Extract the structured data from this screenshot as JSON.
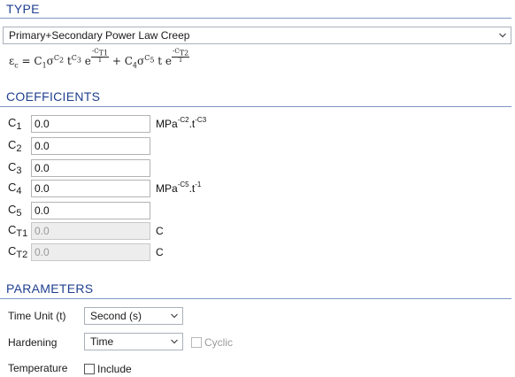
{
  "type_section": {
    "title": "TYPE",
    "model_select": {
      "value": "Primary+Secondary Power Law Creep"
    }
  },
  "formula": {
    "lhs": "ε",
    "lhs_sub": "c",
    "eq": " = C",
    "c1_sub": "1",
    "sigma1": "σ",
    "c2_sup": "C",
    "c2_sup_sub": "2",
    "t1": " t",
    "c3_sup": "C",
    "c3_sup_sub": "3",
    "e1": " e",
    "frac1_num": "-C",
    "frac1_num_sub": "T1",
    "frac1_den": "T",
    "plus": "  + C",
    "c4_sub": "4",
    "sigma2": "σ",
    "c5_sup": "C",
    "c5_sup_sub": "5",
    "t2": " t e",
    "frac2_num": "-C",
    "frac2_num_sub": "T2",
    "frac2_den": "T"
  },
  "coefficients": {
    "title": "COEFFICIENTS",
    "rows": [
      {
        "label": "C",
        "sub": "1",
        "value": "0.0",
        "unit": "MPa",
        "unit_sup1": "-C2",
        "unit_mid": ".t",
        "unit_sup2": "-C3"
      },
      {
        "label": "C",
        "sub": "2",
        "value": "0.0",
        "unit": "",
        "unit_sup1": "",
        "unit_mid": "",
        "unit_sup2": ""
      },
      {
        "label": "C",
        "sub": "3",
        "value": "0.0",
        "unit": "",
        "unit_sup1": "",
        "unit_mid": "",
        "unit_sup2": ""
      },
      {
        "label": "C",
        "sub": "4",
        "value": "0.0",
        "unit": "MPa",
        "unit_sup1": "-C5",
        "unit_mid": ".t",
        "unit_sup2": "-1"
      },
      {
        "label": "C",
        "sub": "5",
        "value": "0.0",
        "unit": "",
        "unit_sup1": "",
        "unit_mid": "",
        "unit_sup2": ""
      },
      {
        "label": "C",
        "sub": "T1",
        "value": "0.0",
        "unit": "C",
        "unit_sup1": "",
        "unit_mid": "",
        "unit_sup2": ""
      },
      {
        "label": "C",
        "sub": "T2",
        "value": "0.0",
        "unit": "C",
        "unit_sup1": "",
        "unit_mid": "",
        "unit_sup2": ""
      }
    ]
  },
  "parameters": {
    "title": "PARAMETERS",
    "time_unit": {
      "label": "Time Unit (t)",
      "value": "Second (s)"
    },
    "hardening": {
      "label": "Hardening",
      "value": "Time",
      "cyclic_label": "Cyclic",
      "cyclic_checked": false
    },
    "temperature": {
      "label": "Temperature",
      "include_label": "Include",
      "include_checked": false
    }
  },
  "colors": {
    "section_title": "#1f3f8f",
    "section_rule": "#7f96c8",
    "disabled_field": "#ededed"
  },
  "icons": {
    "dropdown": "chevron-down-icon"
  }
}
